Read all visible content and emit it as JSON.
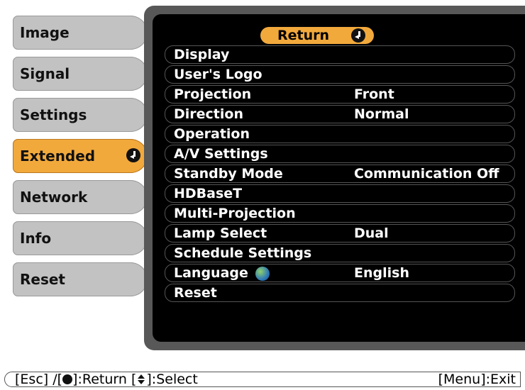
{
  "left_menu": {
    "items": [
      {
        "label": "Image"
      },
      {
        "label": "Signal"
      },
      {
        "label": "Settings"
      },
      {
        "label": "Extended",
        "selected": true
      },
      {
        "label": "Network"
      },
      {
        "label": "Info"
      },
      {
        "label": "Reset"
      }
    ]
  },
  "panel": {
    "return_label": "Return",
    "rows": [
      {
        "label": "Display",
        "value": ""
      },
      {
        "label": "User's Logo",
        "value": ""
      },
      {
        "label": "Projection",
        "value": "Front"
      },
      {
        "label": "Direction",
        "value": "Normal"
      },
      {
        "label": "Operation",
        "value": ""
      },
      {
        "label": "A/V Settings",
        "value": ""
      },
      {
        "label": "Standby Mode",
        "value": "Communication Off"
      },
      {
        "label": "HDBaseT",
        "value": ""
      },
      {
        "label": "Multi-Projection",
        "value": ""
      },
      {
        "label": "Lamp Select",
        "value": "Dual"
      },
      {
        "label": "Schedule Settings",
        "value": ""
      },
      {
        "label": "Language",
        "value": "English",
        "icon": "globe-icon"
      },
      {
        "label": "Reset",
        "value": ""
      }
    ]
  },
  "footer": {
    "esc_label": "[Esc] /[",
    "return_label": "]:Return",
    "select_prefix": "[",
    "select_label": "]:Select",
    "exit_label": "[Menu]:Exit"
  },
  "colors": {
    "accent": "#f2a93c",
    "inactive_tab": "#c2c2c2",
    "panel_bg": "#000000",
    "panel_frame": "#585858"
  }
}
